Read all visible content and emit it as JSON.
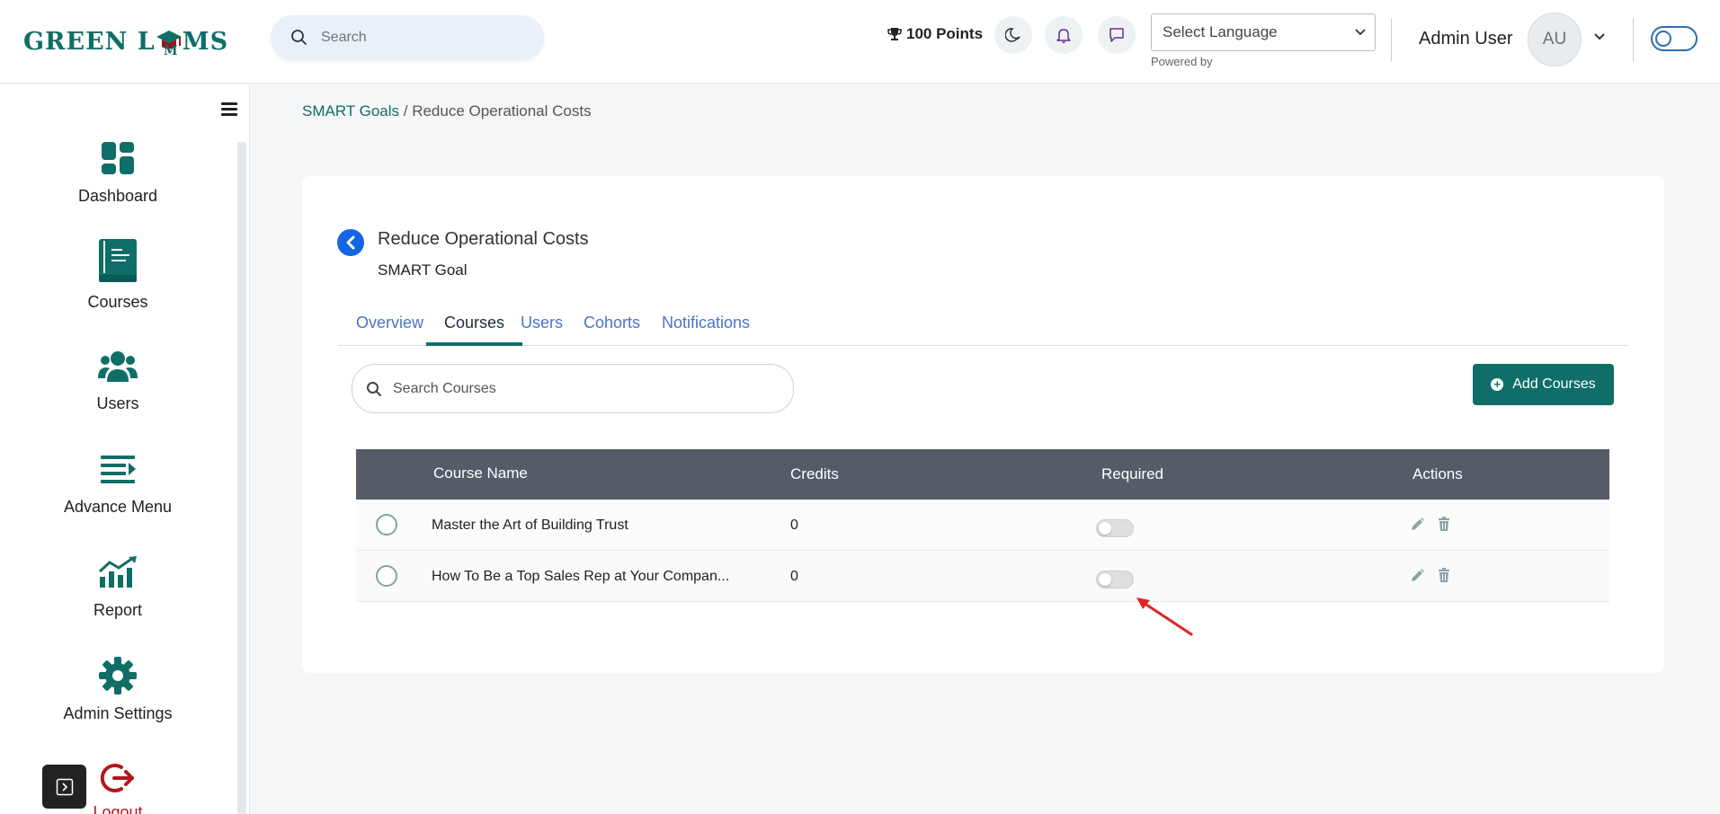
{
  "header": {
    "logo_left": "GREEN L",
    "logo_right": "MS",
    "search_placeholder": "Search",
    "points": "100 Points",
    "language_placeholder": "Select Language",
    "powered_by": "Powered by",
    "user_name": "Admin User",
    "avatar_initials": "AU"
  },
  "sidebar": {
    "items": [
      {
        "label": "Dashboard",
        "icon": "dashboard-icon"
      },
      {
        "label": "Courses",
        "icon": "book-icon"
      },
      {
        "label": "Users",
        "icon": "users-icon"
      },
      {
        "label": "Advance Menu",
        "icon": "menu-icon"
      },
      {
        "label": "Report",
        "icon": "report-icon"
      },
      {
        "label": "Admin Settings",
        "icon": "gear-icon"
      },
      {
        "label": "Logout",
        "icon": "logout-icon"
      }
    ]
  },
  "breadcrumb": {
    "link": "SMART Goals",
    "separator": " / ",
    "current": "Reduce Operational Costs"
  },
  "goal": {
    "title": "Reduce Operational Costs",
    "subtitle": "SMART Goal"
  },
  "tabs": [
    "Overview",
    "Courses",
    "Users",
    "Cohorts",
    "Notifications"
  ],
  "active_tab": "Courses",
  "courses": {
    "search_placeholder": "Search Courses",
    "add_button": "Add Courses",
    "columns": [
      "Course Name",
      "Credits",
      "Required",
      "Actions"
    ],
    "rows": [
      {
        "name": "Master the Art of Building Trust",
        "credits": "0",
        "required": false
      },
      {
        "name": "How To Be a Top Sales Rep at Your Compan...",
        "credits": "0",
        "required": false
      }
    ]
  },
  "colors": {
    "brand": "#0f6e67",
    "header_row": "#555b67",
    "tab_link": "#4b73c8",
    "back_button": "#1464e6",
    "annotation_arrow": "#e02424"
  }
}
